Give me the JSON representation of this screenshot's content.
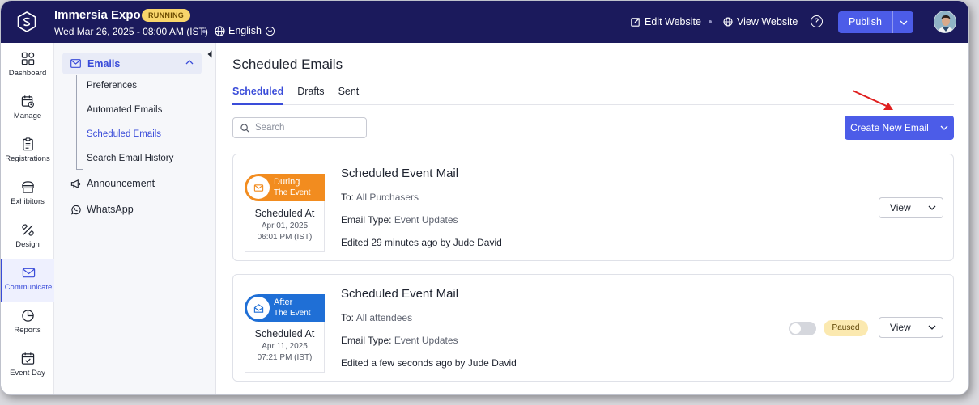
{
  "header": {
    "event_title": "Immersia Expo",
    "status_badge": "RUNNING",
    "event_datetime": "Wed Mar 26, 2025 - 08:00 AM (IST)",
    "language": "English",
    "edit_website": "Edit Website",
    "view_website": "View Website",
    "help": "?",
    "publish": "Publish"
  },
  "rail": {
    "items": [
      {
        "label": "Dashboard",
        "icon": "dashboard-icon"
      },
      {
        "label": "Manage",
        "icon": "calendar-gear-icon"
      },
      {
        "label": "Registrations",
        "icon": "clipboard-icon"
      },
      {
        "label": "Exhibitors",
        "icon": "booth-icon"
      },
      {
        "label": "Design",
        "icon": "design-icon"
      },
      {
        "label": "Communicate",
        "icon": "mail-icon"
      },
      {
        "label": "Reports",
        "icon": "pie-chart-icon"
      },
      {
        "label": "Event Day",
        "icon": "calendar-check-icon"
      }
    ]
  },
  "subnav": {
    "emails": "Emails",
    "sub_items": [
      "Preferences",
      "Automated Emails",
      "Scheduled Emails",
      "Search Email History"
    ],
    "announcement": "Announcement",
    "whatsapp": "WhatsApp"
  },
  "main": {
    "title": "Scheduled Emails",
    "tabs": [
      "Scheduled",
      "Drafts",
      "Sent"
    ],
    "search_placeholder": "Search",
    "create_button": "Create New Email",
    "cards": [
      {
        "badge_line1": "During",
        "badge_line2": "The Event",
        "badge_color": "#f28c1f",
        "scheduled_at_label": "Scheduled At",
        "date": "Apr 01, 2025",
        "time": "06:01 PM (IST)",
        "title": "Scheduled Event Mail",
        "to_label": "To:",
        "to_value": "All Purchasers",
        "type_label": "Email Type:",
        "type_value": "Event Updates",
        "edited": "Edited 29 minutes ago by",
        "editor": "Jude David",
        "view": "View"
      },
      {
        "badge_line1": "After",
        "badge_line2": "The Event",
        "badge_color": "#1f6fd6",
        "scheduled_at_label": "Scheduled At",
        "date": "Apr 11, 2025",
        "time": "07:21 PM (IST)",
        "title": "Scheduled Event Mail",
        "to_label": "To:",
        "to_value": "All attendees",
        "type_label": "Email Type:",
        "type_value": "Event Updates",
        "edited": "Edited a few seconds ago by",
        "editor": "Jude David",
        "status": "Paused",
        "view": "View"
      }
    ]
  }
}
